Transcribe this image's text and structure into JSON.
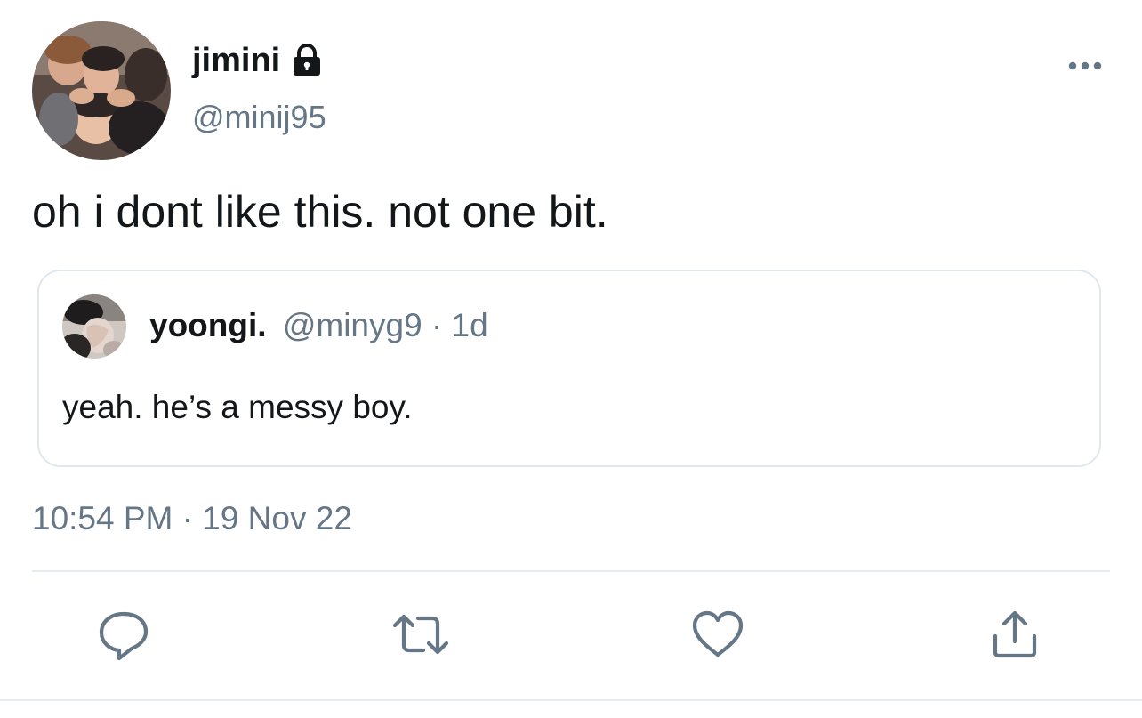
{
  "author": {
    "display_name": "jimini",
    "handle": "@minij95",
    "protected": true,
    "avatar": "group-photo-avatar"
  },
  "tweet": {
    "text": "oh i dont like this. not one bit.",
    "timestamp": "10:54 PM · 19 Nov 22"
  },
  "quoted_tweet": {
    "display_name": "yoongi.",
    "meta": "@minyg9 · 1d",
    "text": "yeah. he’s a messy boy."
  },
  "icons": {
    "lock": "lock-icon",
    "more": "more-options-icon",
    "reply": "reply-icon",
    "retweet": "retweet-icon",
    "like": "heart-icon",
    "share": "share-icon"
  },
  "colors": {
    "text_primary": "#14171a",
    "text_secondary": "#657786",
    "border": "#e1e8ed",
    "icon": "#657786"
  }
}
